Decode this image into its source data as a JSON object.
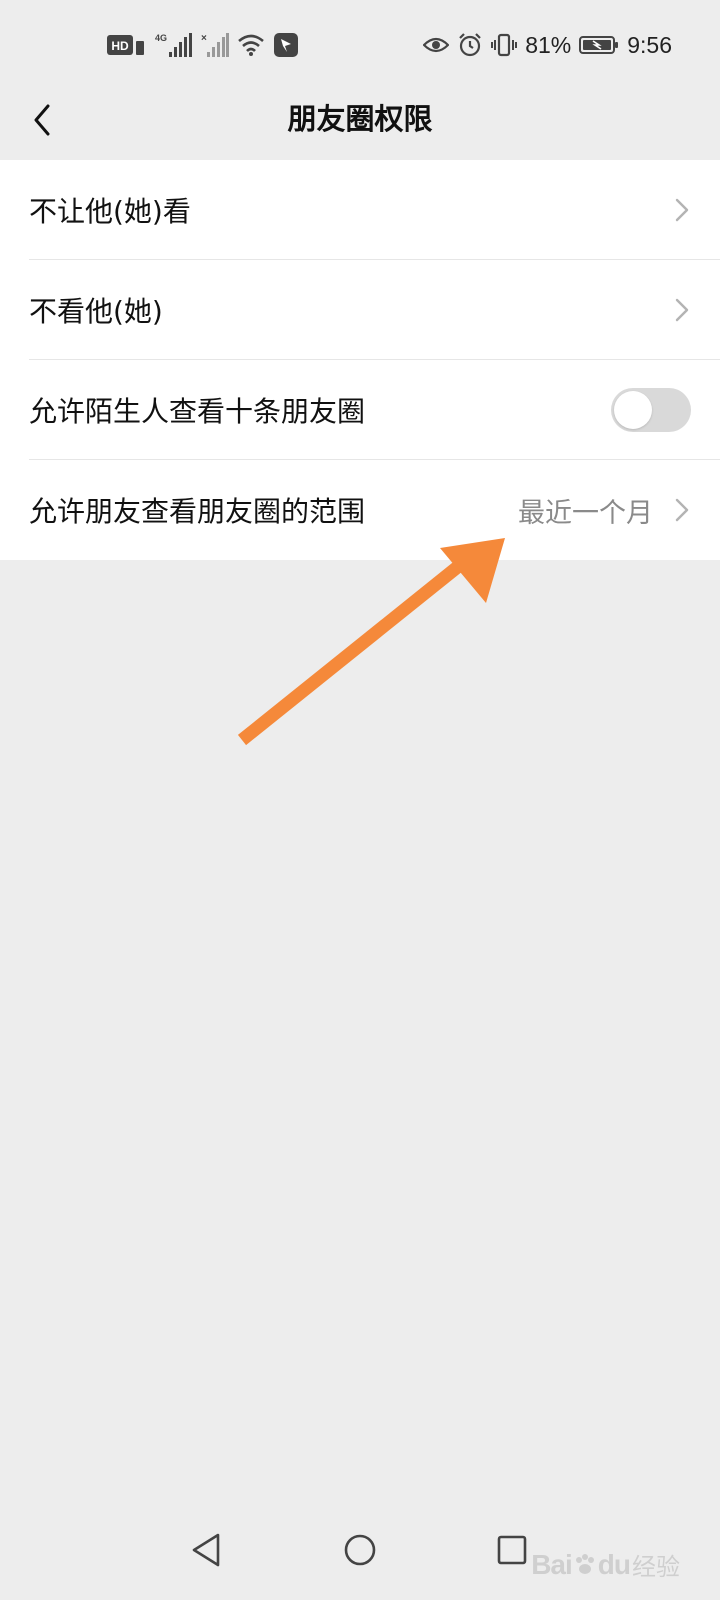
{
  "status_bar": {
    "left_icons": [
      "hd-icon",
      "4g-signal-icon",
      "signal-icon",
      "wifi-icon",
      "app-notification-icon"
    ],
    "network_label": "4G",
    "hd_label": "HD",
    "battery_percent": "81%",
    "time": "9:56",
    "right_icons": [
      "eye-icon",
      "alarm-icon",
      "vibrate-icon",
      "battery-icon"
    ]
  },
  "nav": {
    "title": "朋友圈权限",
    "back_icon": "chevron-left-icon"
  },
  "settings": {
    "rows": [
      {
        "label": "不让他(她)看",
        "type": "link"
      },
      {
        "label": "不看他(她)",
        "type": "link"
      },
      {
        "label": "允许陌生人查看十条朋友圈",
        "type": "toggle",
        "toggle_on": false
      },
      {
        "label": "允许朋友查看朋友圈的范围",
        "type": "link",
        "value": "最近一个月"
      }
    ]
  },
  "annotation": {
    "arrow_color": "#f5893a"
  },
  "system_nav": {
    "icons": [
      "triangle-back-icon",
      "circle-home-icon",
      "square-recents-icon"
    ]
  },
  "watermark": {
    "logo": "Bai",
    "logo_suffix": "du",
    "text": "经验"
  },
  "colors": {
    "background": "#ededed",
    "card": "#ffffff",
    "secondary_text": "#8a8a8a",
    "toggle_off": "#d9d9d9"
  }
}
